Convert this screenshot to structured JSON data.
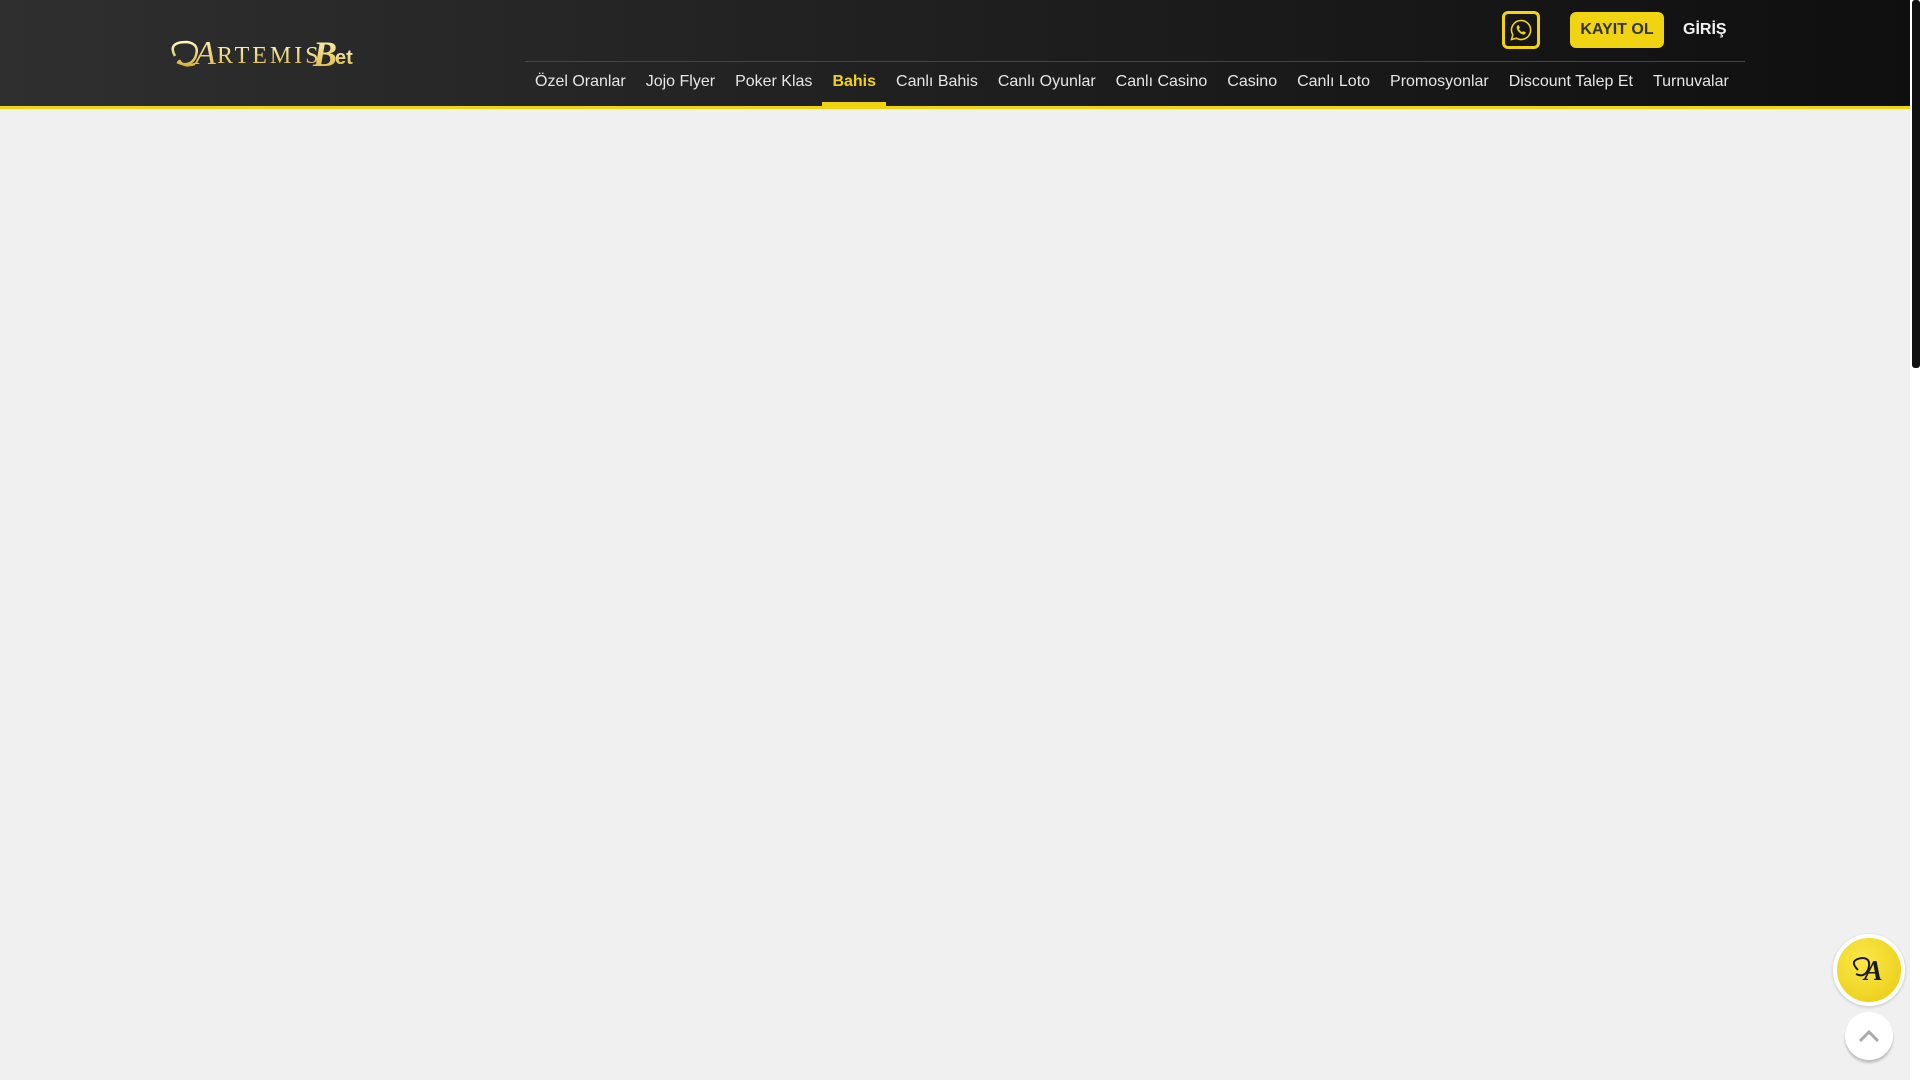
{
  "header": {
    "logo_text": "ArtemisBet",
    "nav": [
      {
        "label": "Özel Oranlar",
        "active": false
      },
      {
        "label": "Jojo Flyer",
        "active": false
      },
      {
        "label": "Poker Klas",
        "active": false
      },
      {
        "label": "Bahis",
        "active": true
      },
      {
        "label": "Canlı Bahis",
        "active": false
      },
      {
        "label": "Canlı Oyunlar",
        "active": false
      },
      {
        "label": "Canlı Casino",
        "active": false
      },
      {
        "label": "Casino",
        "active": false
      },
      {
        "label": "Canlı Loto",
        "active": false
      },
      {
        "label": "Promosyonlar",
        "active": false
      },
      {
        "label": "Discount Talep Et",
        "active": false
      },
      {
        "label": "Turnuvalar",
        "active": false
      }
    ],
    "whatsapp_icon": "whatsapp-icon",
    "register_label": "KAYIT OL",
    "login_label": "GİRİŞ"
  },
  "floating": {
    "chat_logo_text": "A",
    "scroll_top_icon": "chevron-up-icon"
  },
  "colors": {
    "accent": "#f0d412",
    "header": "#1f1f1f",
    "page": "#f0f0f0"
  }
}
